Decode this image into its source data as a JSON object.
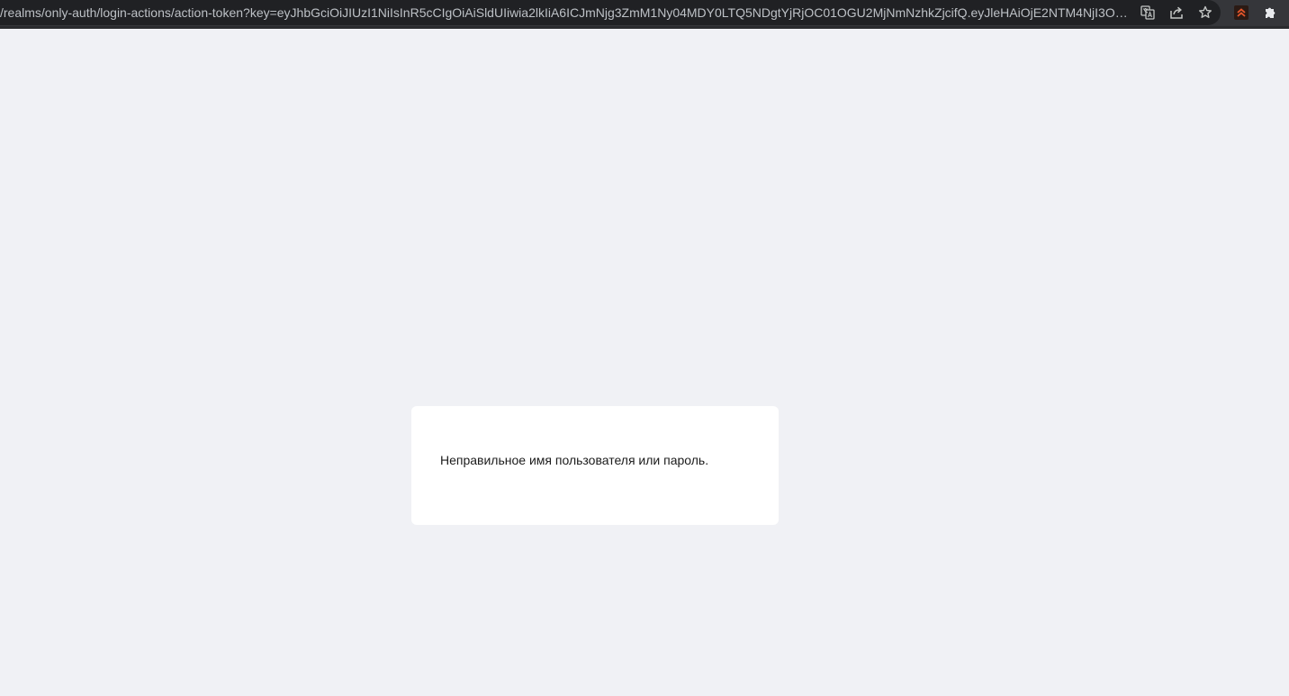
{
  "browser": {
    "url": "/realms/only-auth/login-actions/action-token?key=eyJhbGciOiJIUzI1NiIsInR5cCIgOiAiSldUIiwia2lkIiA6ICJmNjg3ZmM1Ny04MDY0LTQ5NDgtYjRjOC01OGU2MjNmNzhkZjcifQ.eyJleHAiOjE2NTM4NjI3ODgs...",
    "icons": {
      "translate": "translate-icon",
      "share": "share-icon",
      "bookmark": "star-icon",
      "extension": "extension-logo-icon",
      "extensions_menu": "puzzle-icon"
    }
  },
  "main": {
    "message": "Неправильное имя пользователя или пароль."
  },
  "colors": {
    "page_background": "#f0f1f5",
    "card_background": "#ffffff",
    "browser_bar": "#35363a",
    "extension_accent": "#e8562a"
  }
}
